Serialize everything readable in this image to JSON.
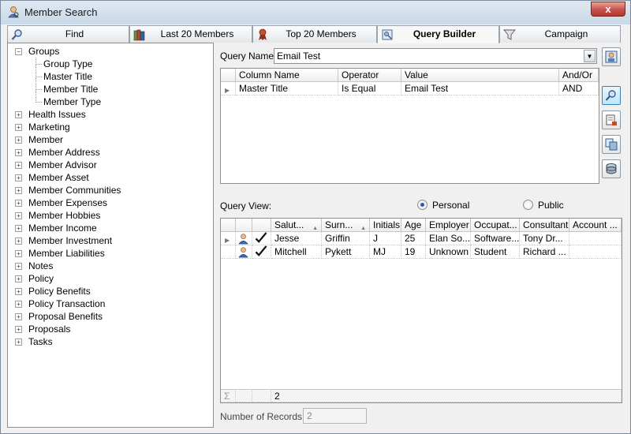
{
  "window": {
    "title": "Member Search",
    "close_glyph": "x"
  },
  "tabs": [
    {
      "label": "Find",
      "icon": "magnifier-icon",
      "active": false
    },
    {
      "label": "Last 20 Members",
      "icon": "books-icon",
      "active": false
    },
    {
      "label": "Top 20 Members",
      "icon": "award-ribbon-icon",
      "active": false
    },
    {
      "label": "Query Builder",
      "icon": "query-icon",
      "active": true
    },
    {
      "label": "Campaign",
      "icon": "funnel-icon",
      "active": false
    }
  ],
  "tree": {
    "root": {
      "label": "Groups",
      "children": [
        "Group Type",
        "Master Title",
        "Member Title",
        "Member Type"
      ]
    },
    "items": [
      "Health Issues",
      "Marketing",
      "Member",
      "Member Address",
      "Member Advisor",
      "Member Asset",
      "Member Communities",
      "Member Expenses",
      "Member Hobbies",
      "Member Income",
      "Member Investment",
      "Member Liabilities",
      "Notes",
      "Policy",
      "Policy Benefits",
      "Policy Transaction",
      "Proposal Benefits",
      "Proposals",
      "Tasks"
    ]
  },
  "query": {
    "name_label": "Query Name:",
    "name_value": "Email Test",
    "columns": [
      "Column Name",
      "Operator",
      "Value",
      "And/Or"
    ],
    "rows": [
      {
        "column": "Master Title",
        "operator": "Is Equal",
        "value": "Email Test",
        "andor": "AND"
      }
    ]
  },
  "view": {
    "label": "Query View:",
    "options": [
      {
        "label": "Personal",
        "selected": true
      },
      {
        "label": "Public",
        "selected": false
      }
    ]
  },
  "results": {
    "columns": [
      "Salut...",
      "Surn...",
      "Initials",
      "Age",
      "Employer",
      "Occupat...",
      "Consultant",
      "Account ..."
    ],
    "rows": [
      {
        "salutation": "Jesse",
        "surname": "Griffin",
        "initials": "J",
        "age": "25",
        "employer": "Elan So...",
        "occupation": "Software...",
        "consultant": "Tony Dr...",
        "account": ""
      },
      {
        "salutation": "Mitchell",
        "surname": "Pykett",
        "initials": "MJ",
        "age": "19",
        "employer": "Unknown",
        "occupation": "Student",
        "consultant": "Richard ...",
        "account": ""
      }
    ],
    "sigma": "Σ",
    "count": "2"
  },
  "footer": {
    "records_label": "Number of Records:",
    "records_value": "2"
  }
}
